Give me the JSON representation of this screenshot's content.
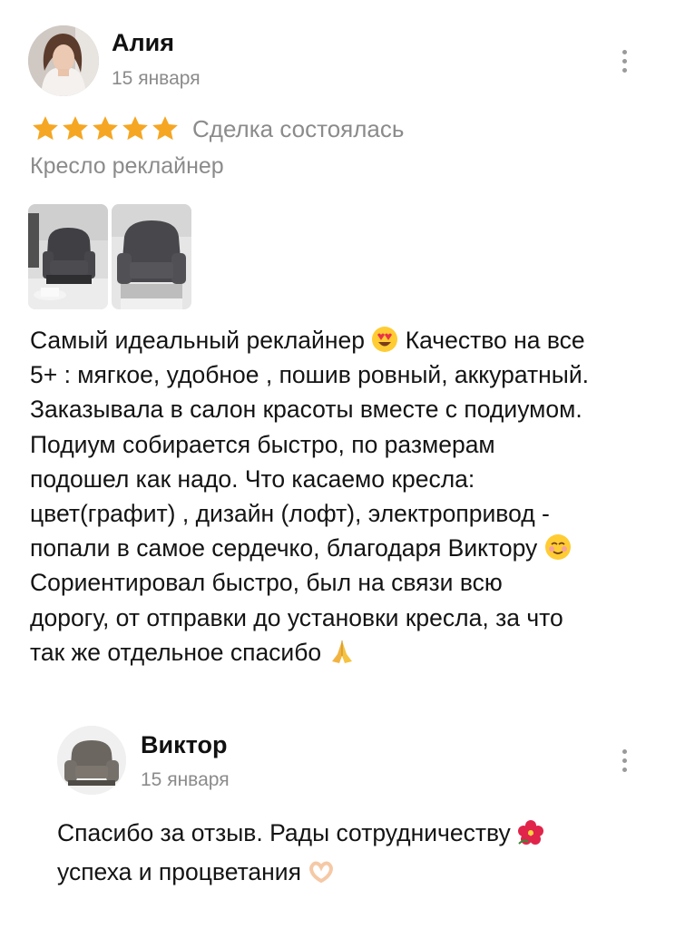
{
  "review": {
    "author": "Алия",
    "date": "15 января",
    "rating": 5,
    "deal_status": "Сделка состоялась",
    "product": "Кресло реклайнер",
    "lines": [
      "Самый идеальный реклайнер",
      "Качество на все",
      "5+ : мягкое, удобное , пошив ровный, аккуратный.",
      "Заказывала в салон красоты вместе с подиумом.",
      "Подиум собирается быстро, по размерам",
      "подошел как надо. Что касаемо кресла:",
      "цвет(графит) , дизайн (лофт), электропривод  -",
      "попали в самое сердечко, благодаря Виктору",
      "Сориентировал быстро, был на связи всю",
      "дорогу, от отправки до установки кресла, за что",
      "так же отдельное спасибо"
    ],
    "emojis": [
      "heart-eyes-emoji",
      "smiling-face-emoji",
      "folded-hands-emoji"
    ]
  },
  "reply": {
    "author": "Виктор",
    "date": "15 января",
    "lines": [
      "Спасибо за отзыв. Рады сотрудничеству",
      "успеха и процветания"
    ],
    "emojis": [
      "hibiscus-emoji",
      "heart-hands-emoji"
    ]
  },
  "colors": {
    "star": "#f5a623",
    "muted_text": "#8b8b8b",
    "text": "#141414"
  }
}
